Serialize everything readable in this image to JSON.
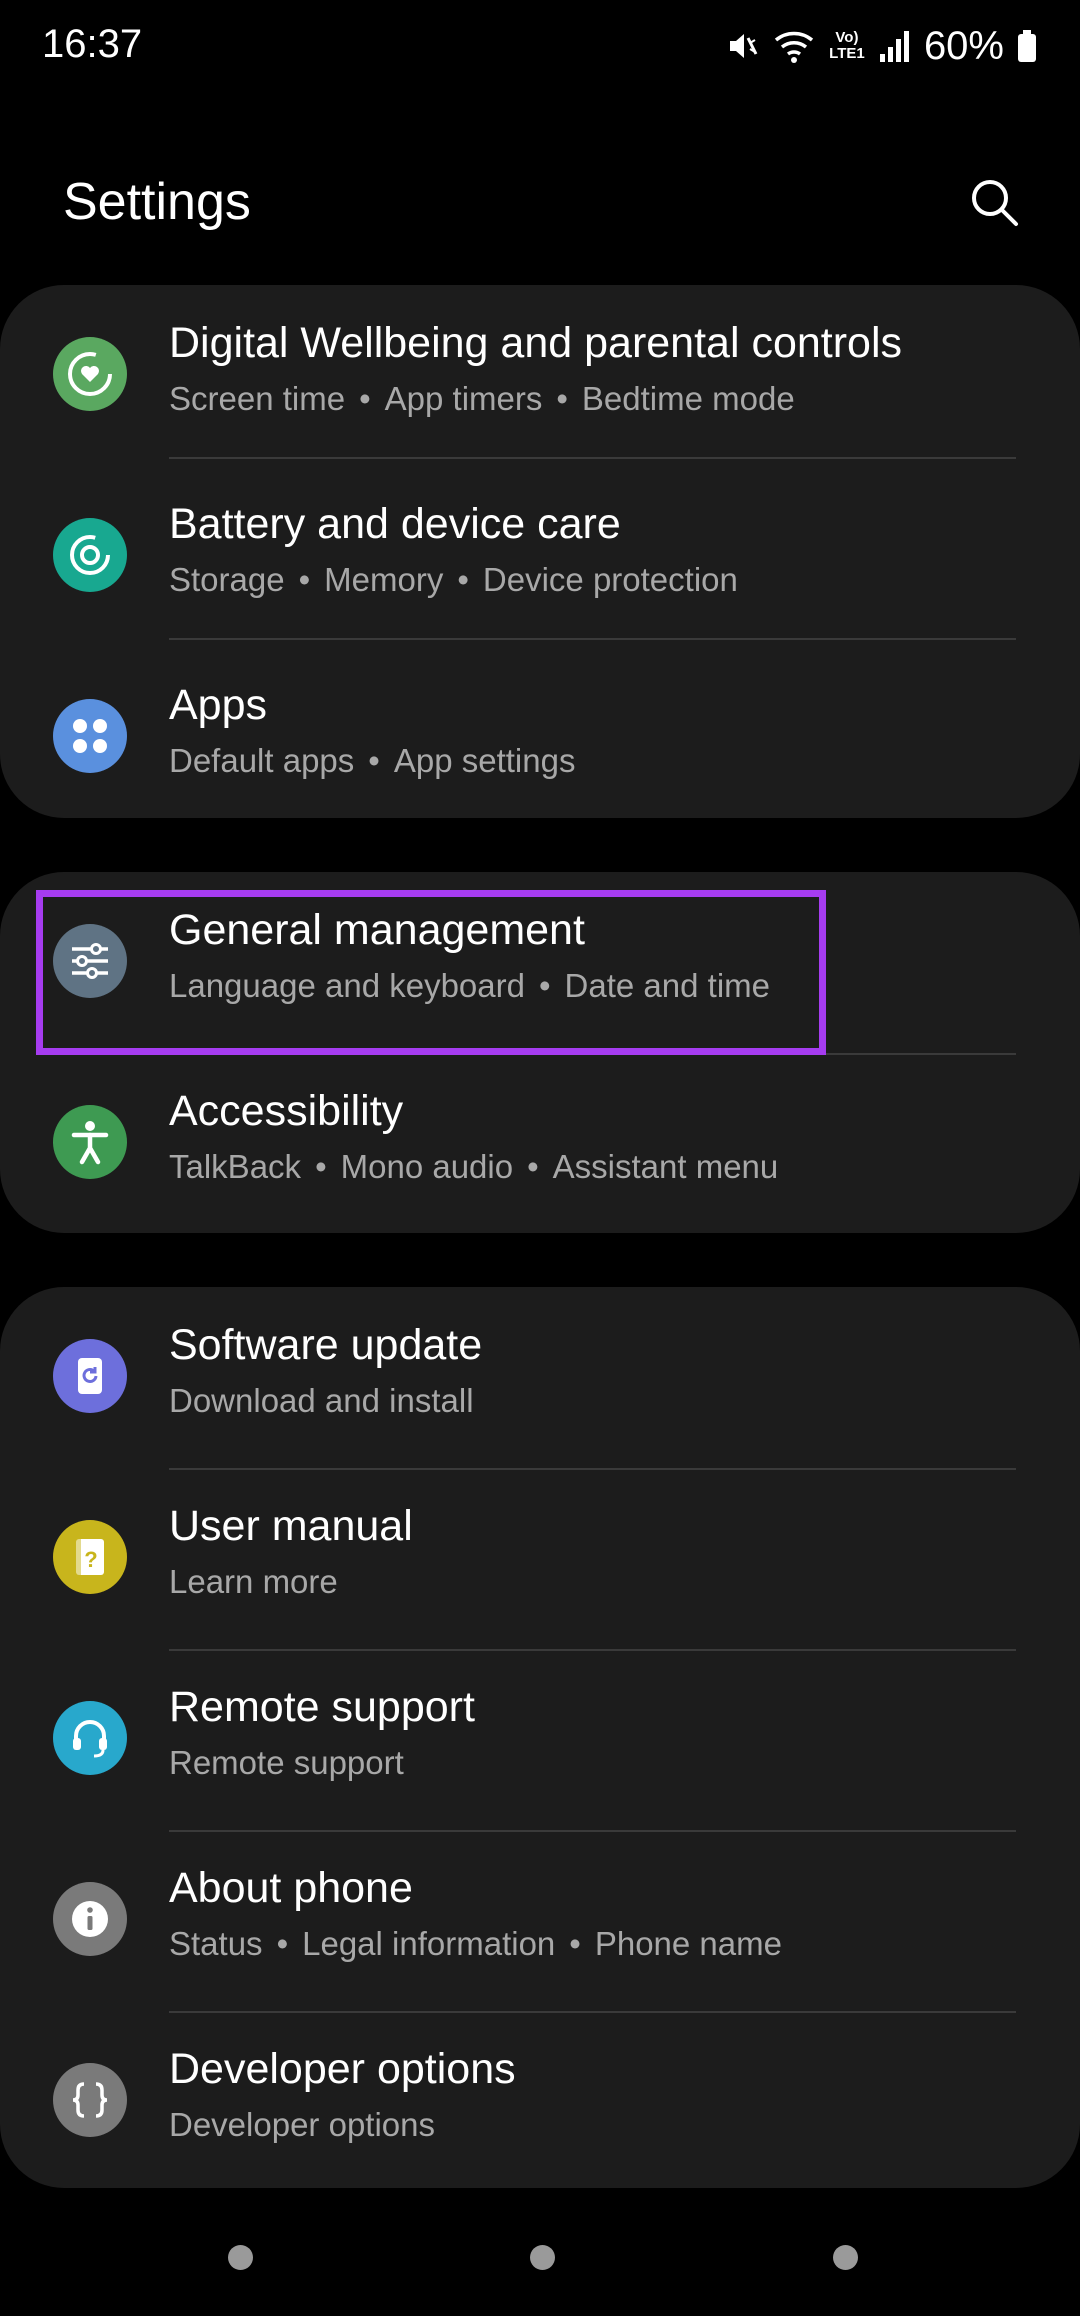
{
  "status_bar": {
    "time": "16:37",
    "battery": "60%",
    "network_label": "Vo) LTE1",
    "icons": [
      "mute-icon",
      "wifi-icon",
      "volte-icon",
      "signal-icon",
      "battery-icon"
    ]
  },
  "header": {
    "title": "Settings",
    "search_icon": "search-icon"
  },
  "groups": [
    {
      "items": [
        {
          "title": "Digital Wellbeing and parental controls",
          "subtitle": [
            "Screen time",
            "App timers",
            "Bedtime mode"
          ],
          "icon": "digital-wellbeing-icon",
          "color": "#5aa860"
        },
        {
          "title": "Battery and device care",
          "subtitle": [
            "Storage",
            "Memory",
            "Device protection"
          ],
          "icon": "device-care-icon",
          "color": "#18a890"
        },
        {
          "title": "Apps",
          "subtitle": [
            "Default apps",
            "App settings"
          ],
          "icon": "apps-icon",
          "color": "#5a90de"
        }
      ]
    },
    {
      "items": [
        {
          "title": "General management",
          "subtitle": [
            "Language and keyboard",
            "Date and time"
          ],
          "icon": "sliders-icon",
          "color": "#5f7384"
        },
        {
          "title": "Accessibility",
          "subtitle": [
            "TalkBack",
            "Mono audio",
            "Assistant menu"
          ],
          "icon": "accessibility-icon",
          "color": "#3e9a52"
        }
      ]
    },
    {
      "items": [
        {
          "title": "Software update",
          "subtitle": [
            "Download and install"
          ],
          "icon": "software-update-icon",
          "color": "#6d6fdc"
        },
        {
          "title": "User manual",
          "subtitle": [
            "Learn more"
          ],
          "icon": "user-manual-icon",
          "color": "#c8b51c"
        },
        {
          "title": "Remote support",
          "subtitle": [
            "Remote support"
          ],
          "icon": "headset-icon",
          "color": "#28a8cc"
        },
        {
          "title": "About phone",
          "subtitle": [
            "Status",
            "Legal information",
            "Phone name"
          ],
          "icon": "info-icon",
          "color": "#7a7a7a"
        },
        {
          "title": "Developer options",
          "subtitle": [
            "Developer options"
          ],
          "icon": "braces-icon",
          "color": "#7a7a7a"
        }
      ]
    }
  ],
  "highlight_color": "#a63cf0",
  "nav_bar": {
    "icons": [
      "recents-icon",
      "home-icon",
      "back-icon"
    ]
  }
}
